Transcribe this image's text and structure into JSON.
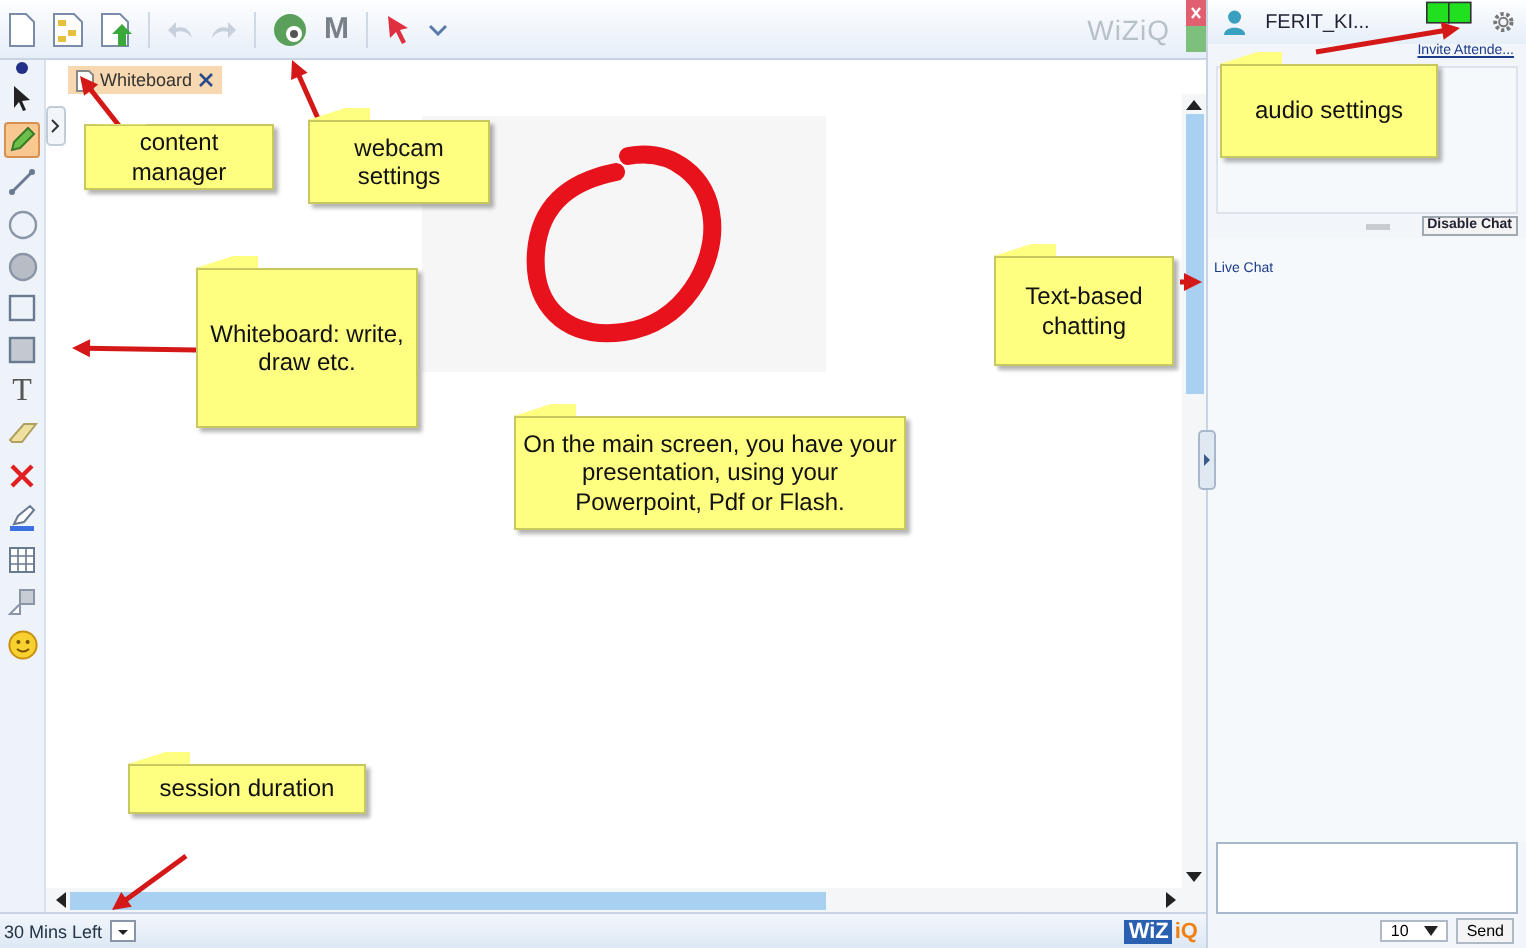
{
  "toolbar": {
    "menu_letter": "M",
    "brand": "WiZiQ"
  },
  "tools": [
    {
      "kind": "pointer",
      "selected": false
    },
    {
      "kind": "pen",
      "selected": true
    },
    {
      "kind": "line",
      "selected": false
    },
    {
      "kind": "circle",
      "selected": false
    },
    {
      "kind": "filled-circle",
      "selected": false
    },
    {
      "kind": "square",
      "selected": false
    },
    {
      "kind": "filled-square",
      "selected": false
    },
    {
      "kind": "text",
      "glyph": "T",
      "selected": false
    },
    {
      "kind": "eraser",
      "selected": false
    },
    {
      "kind": "delete",
      "selected": false
    },
    {
      "kind": "highlighter",
      "selected": false
    },
    {
      "kind": "grid",
      "selected": false
    },
    {
      "kind": "cube",
      "selected": false
    },
    {
      "kind": "smiley",
      "selected": false
    }
  ],
  "tab": {
    "label": "Whiteboard"
  },
  "status_bar": {
    "time_left": "30 Mins Left",
    "logo_left": "WiZ",
    "logo_right": "iQ"
  },
  "side_panel": {
    "user_name": "FERIT_KI...",
    "invite_link": "Invite Attende...",
    "disable_chat": "Disable Chat",
    "chat_title": "Live Chat",
    "font_size": "10",
    "send": "Send"
  },
  "annotations": [
    {
      "text": "content manager"
    },
    {
      "text": "webcam settings"
    },
    {
      "text": "audio settings"
    },
    {
      "text": "Whiteboard: write, draw etc."
    },
    {
      "text": "On the main screen, you have your presentation, using your Powerpoint, Pdf or Flash."
    },
    {
      "text": "Text-based chatting"
    },
    {
      "text": "session duration"
    }
  ]
}
